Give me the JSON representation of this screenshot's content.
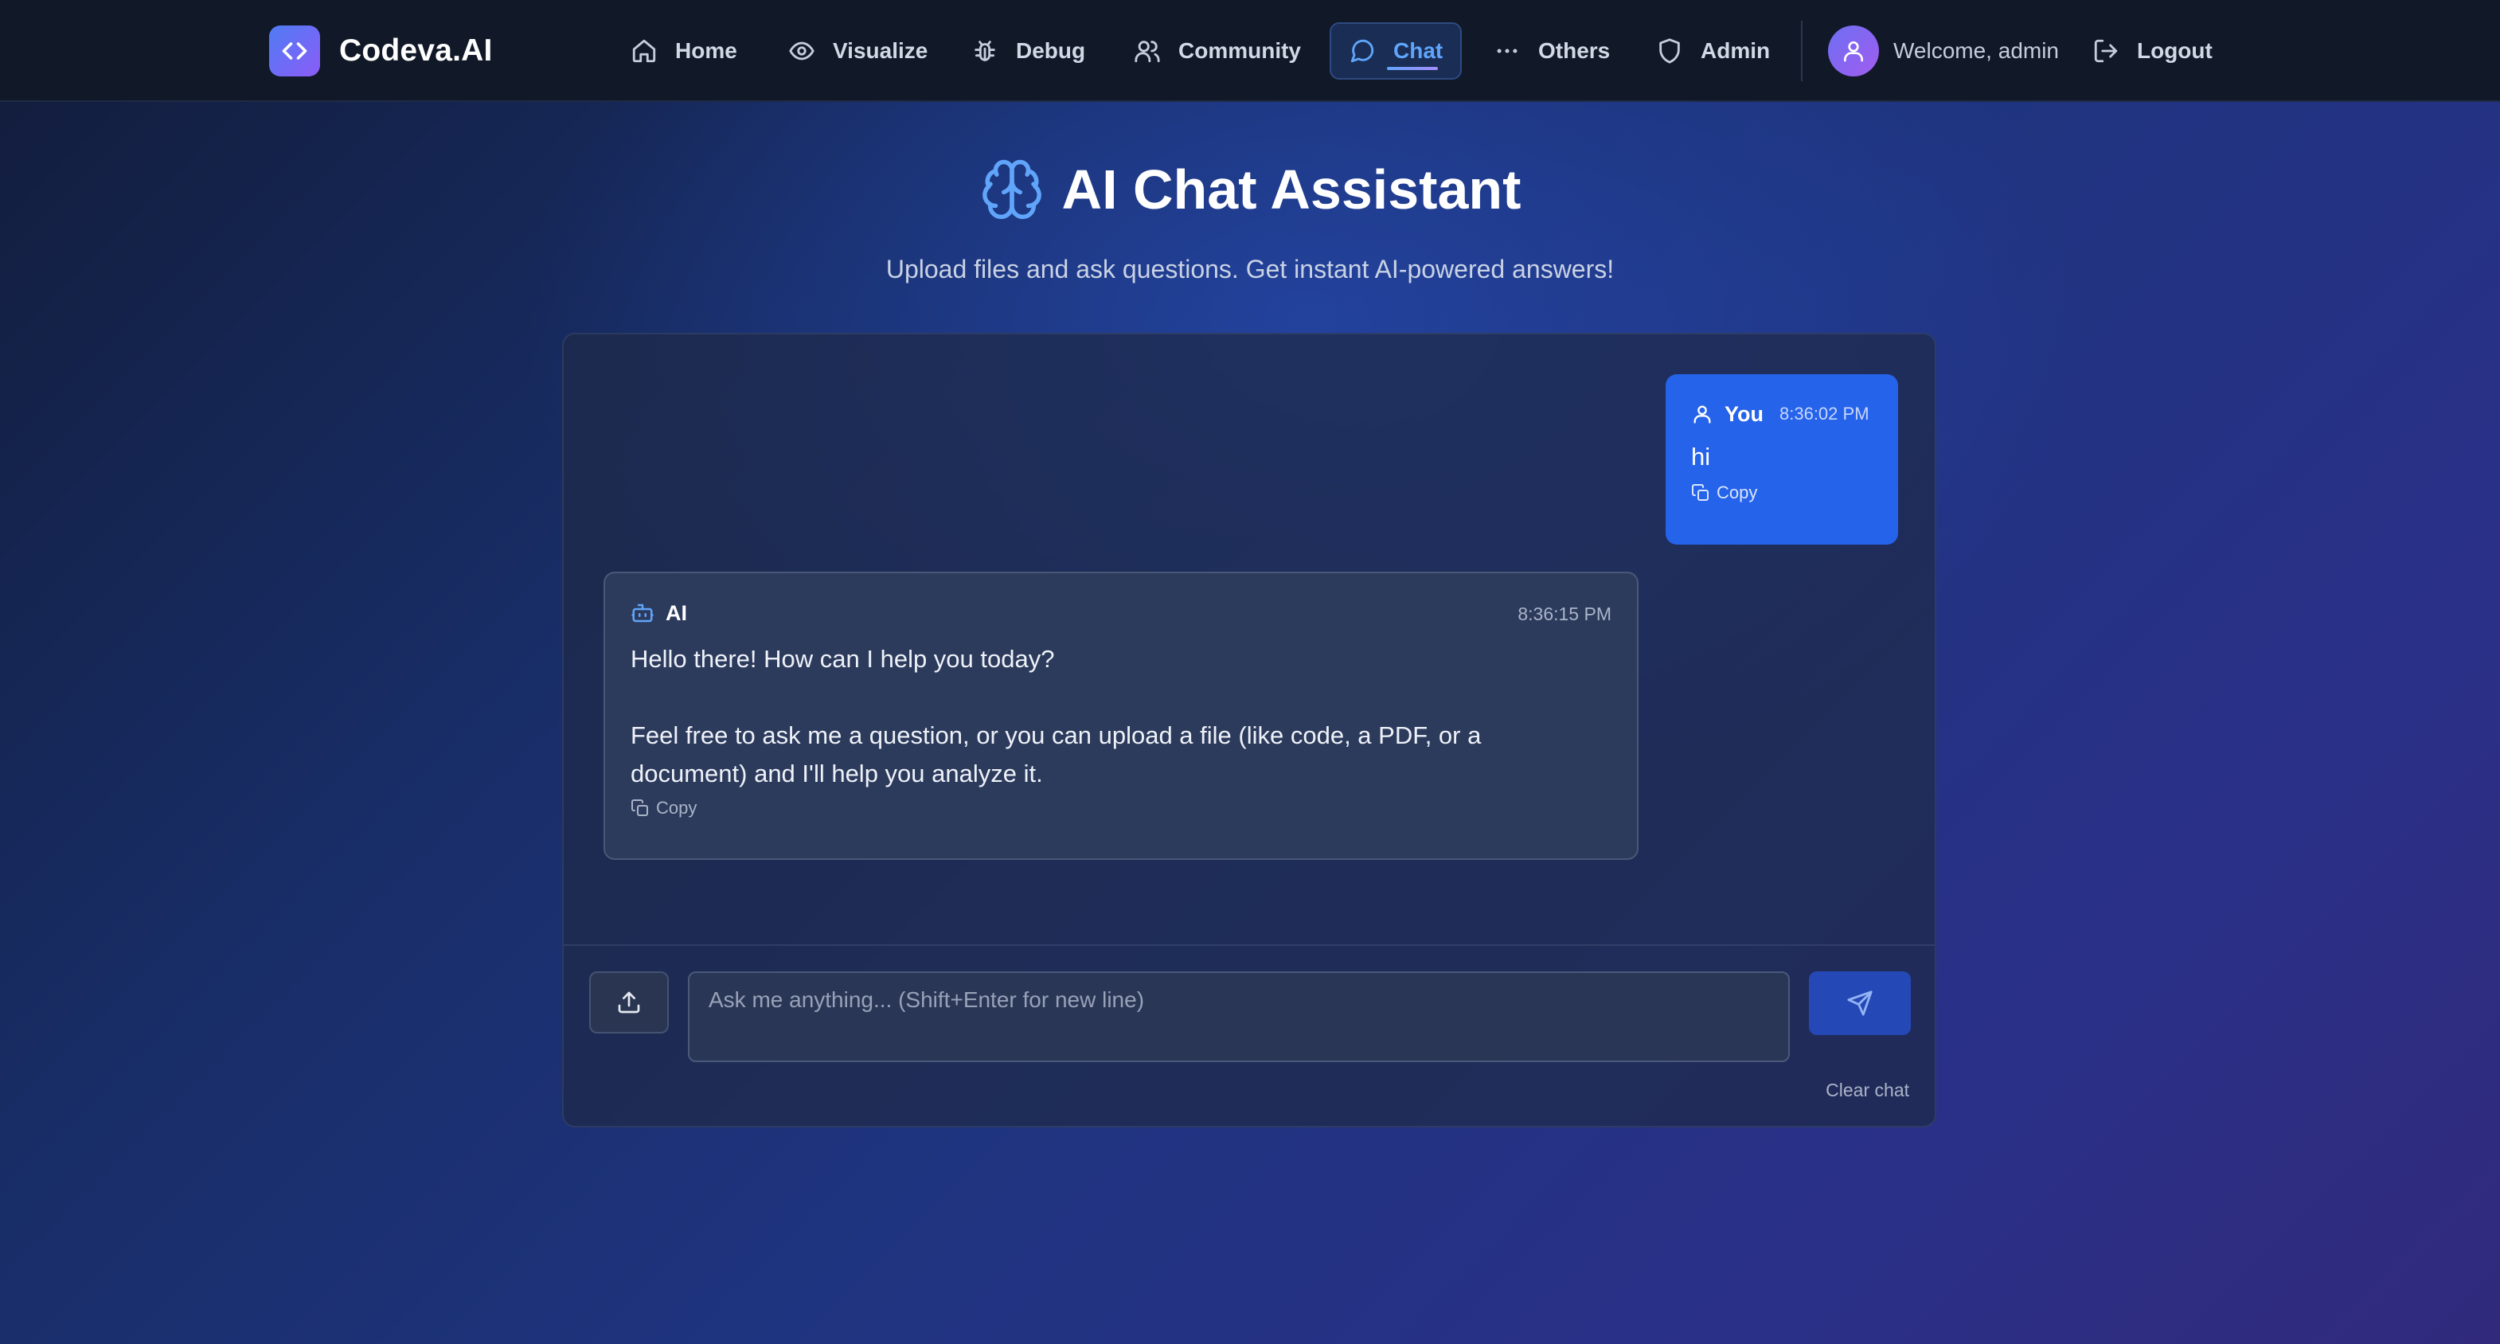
{
  "app": {
    "name": "Codeva.AI"
  },
  "nav": {
    "items": [
      {
        "label": "Home",
        "icon": "home-icon"
      },
      {
        "label": "Visualize",
        "icon": "eye-icon"
      },
      {
        "label": "Debug",
        "icon": "bug-icon"
      },
      {
        "label": "Community",
        "icon": "users-icon"
      },
      {
        "label": "Chat",
        "icon": "message-circle-icon",
        "active": true
      },
      {
        "label": "Others",
        "icon": "more-horizontal-icon"
      },
      {
        "label": "Admin",
        "icon": "shield-icon"
      }
    ],
    "welcome": "Welcome, admin",
    "logout": "Logout"
  },
  "header": {
    "title": "AI Chat Assistant",
    "subtitle": "Upload files and ask questions. Get instant AI-powered answers!",
    "icon": "brain-icon"
  },
  "messages": [
    {
      "author": "You",
      "time": "8:36:02 PM",
      "text": "hi",
      "copy_label": "Copy"
    },
    {
      "author": "AI",
      "time": "8:36:15 PM",
      "text": "Hello there! How can I help you today?\n\nFeel free to ask me a question, or you can upload a file (like code, a PDF, or a\ndocument) and I'll help you analyze it.",
      "copy_label": "Copy"
    }
  ],
  "composer": {
    "placeholder": "Ask me anything... (Shift+Enter for new line)",
    "value": "",
    "clear_label": "Clear chat"
  },
  "colors": {
    "accent": "#2563eb",
    "active_nav": "#60a5fa",
    "navbar": "#111827",
    "logo_gradient": [
      "#4f7cf5",
      "#8b5cf6"
    ]
  }
}
